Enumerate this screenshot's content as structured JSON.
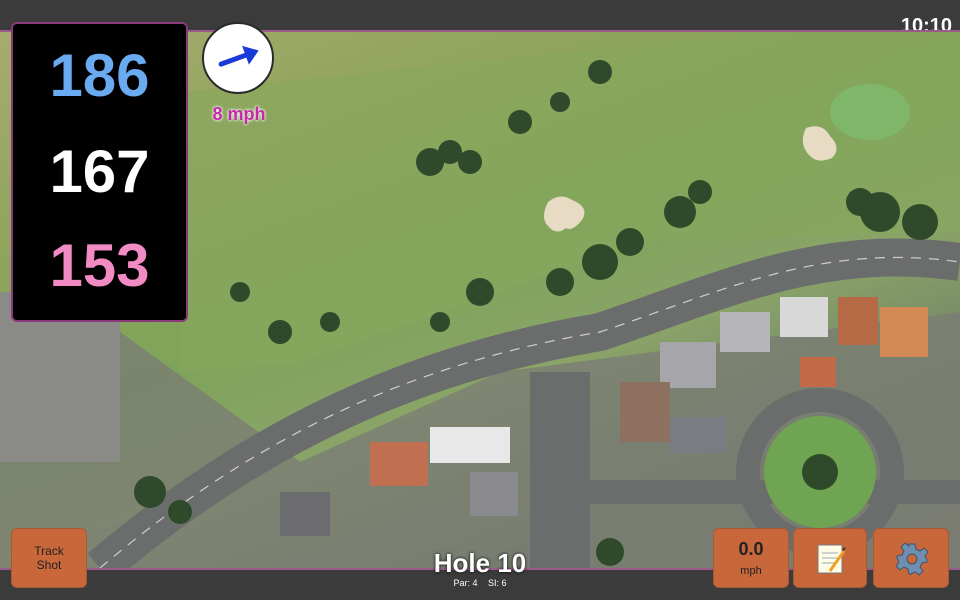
{
  "status": {
    "time": "10:10"
  },
  "distances": {
    "back": "186",
    "middle": "167",
    "front": "153"
  },
  "wind": {
    "speed": "8 mph",
    "icon": "wind-direction-arrow-icon"
  },
  "track_shot": {
    "line1": "Track",
    "line2": "Shot"
  },
  "hole": {
    "title": "Hole 10",
    "par": "Par: 4",
    "si": "SI: 6"
  },
  "speed": {
    "value": "0.0",
    "unit": "mph"
  },
  "icons": {
    "notes": "notepad-icon",
    "settings": "gear-icon"
  },
  "colors": {
    "back": "#6aaaf0",
    "middle": "#ffffff",
    "front": "#f28ac4",
    "wind_text": "#c42aa8",
    "button": "#c8673a"
  }
}
